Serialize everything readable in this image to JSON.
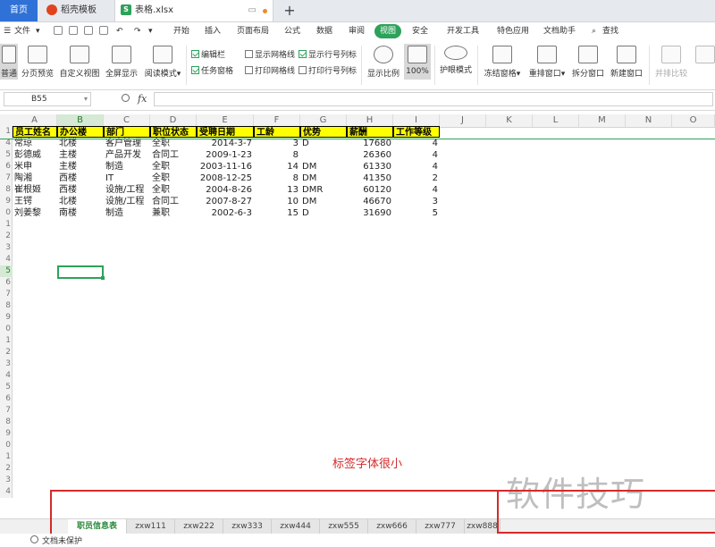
{
  "tabs": {
    "home": "首页",
    "template": "稻壳模板",
    "file": "表格.xlsx",
    "add": "+"
  },
  "menu": {
    "file": "文件",
    "items": [
      "开始",
      "插入",
      "页面布局",
      "公式",
      "数据",
      "审阅",
      "视图",
      "安全",
      "开发工具",
      "特色应用",
      "文档助手"
    ],
    "active": "视图",
    "search": "查找"
  },
  "ribbon": {
    "normal": "普通",
    "page_break": "分页预览",
    "custom_view": "自定义视图",
    "fullscreen": "全屏显示",
    "reading_mode": "阅读模式",
    "edit_bar": "编辑栏",
    "task_pane": "任务窗格",
    "show_gridlines": "显示网格线",
    "print_gridlines": "打印网格线",
    "show_rowcol": "显示行号列标",
    "print_rowcol": "打印行号列标",
    "zoom": "显示比例",
    "zoom_100": "100%",
    "eye_mode": "护眼模式",
    "freeze": "冻结窗格",
    "arrange": "重排窗口",
    "split": "拆分窗口",
    "new_window": "新建窗口",
    "compare": "并排比较"
  },
  "formula_bar": {
    "cell_ref": "B55",
    "fx": "fx",
    "value": ""
  },
  "grid": {
    "columns": [
      "A",
      "B",
      "C",
      "D",
      "E",
      "F",
      "G",
      "H",
      "I",
      "J",
      "K",
      "L",
      "M",
      "N",
      "O"
    ],
    "selected_column": "B",
    "headers": [
      "员工姓名",
      "办公楼",
      "部门",
      "职位状态",
      "受聘日期",
      "工龄",
      "优势",
      "薪酬",
      "工作等级"
    ],
    "rows": [
      [
        "常琼",
        "北楼",
        "客户管理",
        "全职",
        "2014-3-7",
        "3",
        "D",
        "17680",
        "4"
      ],
      [
        "彭德威",
        "主楼",
        "产品开发",
        "合同工",
        "2009-1-23",
        "8",
        "",
        "26360",
        "4"
      ],
      [
        "米申",
        "主楼",
        "制造",
        "全职",
        "2003-11-16",
        "14",
        "DM",
        "61330",
        "4"
      ],
      [
        "陶湘",
        "西楼",
        "IT",
        "全职",
        "2008-12-25",
        "8",
        "DM",
        "41350",
        "2"
      ],
      [
        "崔根姬",
        "西楼",
        "设施/工程",
        "全职",
        "2004-8-26",
        "13",
        "DMR",
        "60120",
        "4"
      ],
      [
        "王锷",
        "北楼",
        "设施/工程",
        "合同工",
        "2007-8-27",
        "10",
        "DM",
        "46670",
        "3"
      ],
      [
        "刘姜黎",
        "南楼",
        "制造",
        "兼职",
        "2002-6-3",
        "15",
        "D",
        "31690",
        "5"
      ]
    ],
    "row_numbers": [
      "1",
      "4",
      "5",
      "6",
      "7",
      "8",
      "9",
      "0",
      "1",
      "2",
      "3",
      "4",
      "5",
      "6",
      "7",
      "8",
      "9",
      "0",
      "1",
      "2",
      "3",
      "4",
      "5",
      "6",
      "7",
      "8",
      "9",
      "0",
      "1",
      "2",
      "3",
      "4"
    ],
    "selected_row_number": "5"
  },
  "annotation": {
    "text": "标签字体很小",
    "watermark": "软件技巧"
  },
  "sheets": [
    "职员信息表",
    "zxw111",
    "zxw222",
    "zxw333",
    "zxw444",
    "zxw555",
    "zxw666",
    "zxw777",
    "zxw888"
  ],
  "active_sheet": "职员信息表",
  "status": {
    "protection": "文档未保护"
  },
  "colors": {
    "accent": "#2ca25a",
    "home_tab": "#2f71d6",
    "header_fill": "#ffff00",
    "annotation": "#d42a2a"
  }
}
